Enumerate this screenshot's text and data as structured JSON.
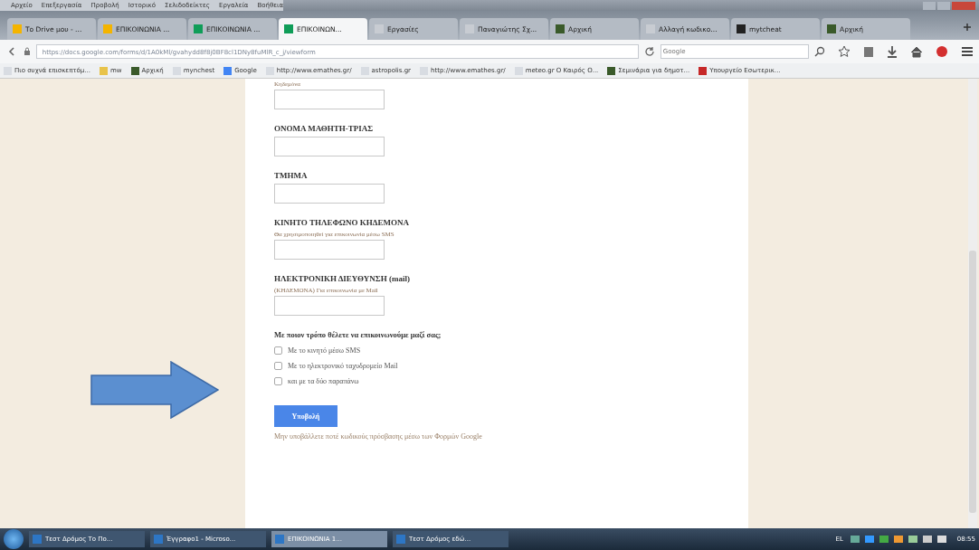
{
  "menu": [
    "Αρχείο",
    "Επεξεργασία",
    "Προβολή",
    "Ιστορικό",
    "Σελιδοδείκτες",
    "Εργαλεία",
    "Βοήθεια"
  ],
  "tabs": [
    {
      "label": "Το Drive μου - ...",
      "selected": false,
      "kind": "drive"
    },
    {
      "label": "ΕΠΙΚΟΙΝΩΝΙΑ ...",
      "selected": false,
      "kind": "drive"
    },
    {
      "label": "ΕΠΙΚΟΙΝΩΝΙΑ ...",
      "selected": false,
      "kind": "form"
    },
    {
      "label": "ΕΠΙΚΟΙΝΩΝ...",
      "selected": true,
      "kind": "form"
    },
    {
      "label": "Εργασίες",
      "selected": false,
      "kind": "page"
    },
    {
      "label": "Παναγιώτης Σχ...",
      "selected": false,
      "kind": "page"
    },
    {
      "label": "Αρχική",
      "selected": false,
      "kind": "app"
    },
    {
      "label": "Αλλαγή κωδικο...",
      "selected": false,
      "kind": "page"
    },
    {
      "label": "mytcheat",
      "selected": false,
      "kind": "pi"
    },
    {
      "label": "Αρχική",
      "selected": false,
      "kind": "app"
    }
  ],
  "address": {
    "url": "https://docs.google.com/forms/d/1A0kMl/gvahydd8f8j0BF8cl1DNy8fuMlR_c_j/viewform",
    "search_placeholder": "Google"
  },
  "bookmarks": [
    {
      "label": "Πιο συχνά επισκεπτόμ...",
      "kind": "page"
    },
    {
      "label": "mw",
      "kind": "folder"
    },
    {
      "label": "Αρχική",
      "kind": "app"
    },
    {
      "label": "mynchest",
      "kind": "page"
    },
    {
      "label": "Google",
      "kind": "google"
    },
    {
      "label": "http://www.emathes.gr/",
      "kind": "page"
    },
    {
      "label": "astropolis.gr",
      "kind": "page"
    },
    {
      "label": "http://www.emathes.gr/",
      "kind": "page"
    },
    {
      "label": "meteo.gr Ο Καιρός Ο...",
      "kind": "page"
    },
    {
      "label": "Σεμινάρια για δημοτ...",
      "kind": "app"
    },
    {
      "label": "Υπουργείο Εσωτερικ...",
      "kind": "flag"
    }
  ],
  "form": {
    "top_hint": "Κηδεμόνα",
    "fields": [
      {
        "label": "ΟΝΟΜΑ ΜΑΘΗΤΗ-ΤΡΙΑΣ"
      },
      {
        "label": "ΤΜΗΜΑ"
      },
      {
        "label": "ΚΙΝΗΤΟ ΤΗΛΕΦΩΝΟ ΚΗΔΕΜΟΝΑ",
        "hint": "Θα χρησιμοποιηθεί για επικοινωνία μέσω SMS"
      },
      {
        "label": "ΗΛΕΚΤΡΟΝΙΚΗ ΔΙΕΥΘΥΝΣΗ (mail)",
        "hint": "(ΚΗΔΕΜΟΝΑ) Για επικοινωνία με Mail"
      }
    ],
    "question": "Με ποιον τρόπο θέλετε να επικοινωνούμε μαζί σας;",
    "options": [
      {
        "label": "Με το κινητό μέσω SMS",
        "checked": false
      },
      {
        "label": "Με το ηλεκτρονικό ταχυδρομείο Mail",
        "checked": false
      },
      {
        "label": "και με τα δύο παραπάνω",
        "checked": false
      }
    ],
    "submit": "Υποβολή",
    "warning": "Μην υποβάλλετε ποτέ κωδικούς πρόσβασης μέσω των Φορμών Google"
  },
  "taskbar": {
    "items": [
      {
        "label": "Τεστ Δρόμος Το Πο...",
        "selected": false
      },
      {
        "label": "Έγγραφο1 - Microso...",
        "selected": false
      },
      {
        "label": "ΕΠΙΚΟΙΝΩΝΙΑ 1...",
        "selected": true
      },
      {
        "label": "Τεστ Δρόμος εδώ...",
        "selected": false
      }
    ],
    "lang": "EL",
    "clock": "08:55"
  }
}
